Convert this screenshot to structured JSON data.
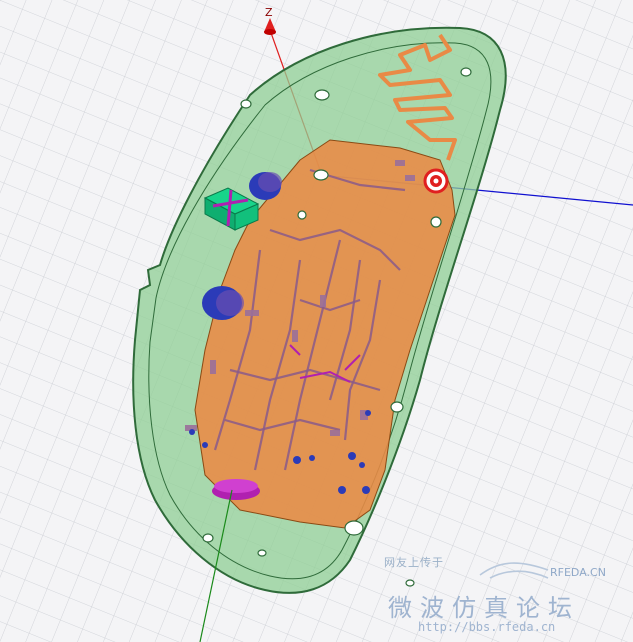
{
  "viewport": {
    "axis_z_label": "Z",
    "colors": {
      "background": "#f4f4f6",
      "grid": "#c9ccd2",
      "board_green": "#7fbf86",
      "board_outline": "#2f6b3a",
      "copper_orange": "#e98a46",
      "trace_purple": "#8a5a8a",
      "axis_red": "#e02020",
      "axis_blue": "#1010d0",
      "axis_green": "#1a8a1a",
      "port_magenta": "#b020b0",
      "via_blue": "#2b3bb8"
    }
  },
  "watermark": {
    "small_text": "网友上传于",
    "brand": "RFEDA.CN",
    "title": "微波仿真论坛",
    "url": "http://bbs.rfeda.cn"
  }
}
